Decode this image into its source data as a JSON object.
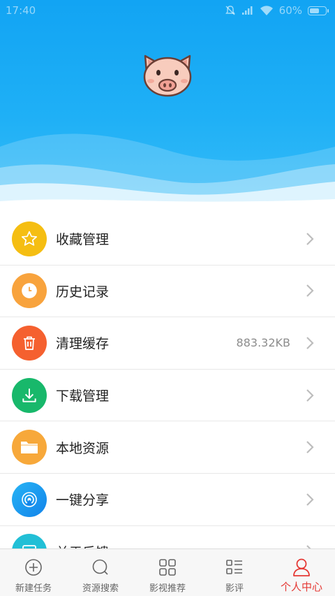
{
  "status_bar": {
    "time": "17:40",
    "battery_text": "60%",
    "battery_level": 0.6,
    "icons": [
      "alarm-off-icon",
      "signal-icon",
      "wifi-icon",
      "battery-icon"
    ]
  },
  "header": {
    "avatar_icon": "pig-avatar-icon",
    "background_color": "#1aa8f4"
  },
  "menu": {
    "items": [
      {
        "label": "收藏管理",
        "icon": "star-icon",
        "color": "#f5be12"
      },
      {
        "label": "历史记录",
        "icon": "clock-icon",
        "color": "#f8a33d"
      },
      {
        "label": "清理缓存",
        "icon": "trash-icon",
        "color": "#f5602f",
        "value": "883.32KB"
      },
      {
        "label": "下载管理",
        "icon": "download-icon",
        "color": "#18b86b"
      },
      {
        "label": "本地资源",
        "icon": "folder-icon",
        "color": "#f7a83a"
      },
      {
        "label": "一键分享",
        "icon": "share-signal-icon",
        "color": "#1594f0"
      },
      {
        "label": "关于反馈",
        "icon": "feedback-icon",
        "color": "#22bfd6"
      }
    ]
  },
  "bottom_nav": {
    "items": [
      {
        "label": "新建任务",
        "icon": "plus-circle-icon"
      },
      {
        "label": "资源搜索",
        "icon": "search-icon"
      },
      {
        "label": "影视推荐",
        "icon": "grid-icon"
      },
      {
        "label": "影评",
        "icon": "list-icon"
      },
      {
        "label": "个人中心",
        "icon": "person-icon",
        "active": true
      }
    ],
    "active_color": "#e53935"
  }
}
